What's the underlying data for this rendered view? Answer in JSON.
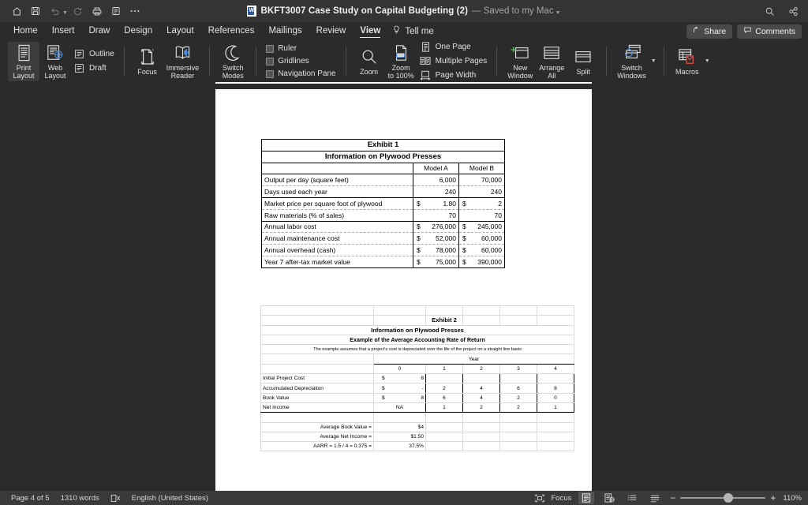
{
  "titlebar": {
    "title": "BKFT3007 Case Study on Capital Budgeting (2)",
    "save_state": "— Saved to my Mac",
    "icons": [
      "home-icon",
      "save-icon",
      "undo-icon",
      "redo-icon",
      "print-icon",
      "quick-print-icon",
      "more-icon"
    ],
    "right_icons": [
      "search-icon",
      "share-link-icon"
    ]
  },
  "tabs": {
    "items": [
      {
        "label": "Home",
        "active": false
      },
      {
        "label": "Insert",
        "active": false
      },
      {
        "label": "Draw",
        "active": false
      },
      {
        "label": "Design",
        "active": false
      },
      {
        "label": "Layout",
        "active": false
      },
      {
        "label": "References",
        "active": false
      },
      {
        "label": "Mailings",
        "active": false
      },
      {
        "label": "Review",
        "active": false
      },
      {
        "label": "View",
        "active": true
      }
    ],
    "tell_me": "Tell me",
    "share_label": "Share",
    "comments_label": "Comments"
  },
  "ribbon": {
    "views": [
      {
        "label": "Print\nLayout",
        "icon": "print-layout-icon",
        "selected": true
      },
      {
        "label": "Web\nLayout",
        "icon": "web-layout-icon",
        "selected": false
      }
    ],
    "view_small": [
      {
        "label": "Outline",
        "icon": "outline-icon"
      },
      {
        "label": "Draft",
        "icon": "draft-icon"
      }
    ],
    "immersive": [
      {
        "label": "Focus",
        "icon": "focus-icon"
      },
      {
        "label": "Immersive\nReader",
        "icon": "immersive-reader-icon"
      },
      {
        "label": "Switch\nModes",
        "icon": "switch-modes-icon"
      }
    ],
    "show": [
      {
        "label": "Ruler",
        "checked": false
      },
      {
        "label": "Gridlines",
        "checked": false
      },
      {
        "label": "Navigation Pane",
        "checked": false
      }
    ],
    "zoom_group": [
      {
        "label": "Zoom",
        "icon": "zoom-icon"
      },
      {
        "label": "Zoom\nto 100%",
        "icon": "zoom-100-icon"
      }
    ],
    "zoom_small": [
      {
        "label": "One Page",
        "icon": "one-page-icon"
      },
      {
        "label": "Multiple Pages",
        "icon": "multiple-pages-icon"
      },
      {
        "label": "Page Width",
        "icon": "page-width-icon"
      }
    ],
    "window": [
      {
        "label": "New\nWindow",
        "icon": "new-window-icon"
      },
      {
        "label": "Arrange\nAll",
        "icon": "arrange-all-icon"
      },
      {
        "label": "Split",
        "icon": "split-icon"
      },
      {
        "label": "Switch\nWindows",
        "icon": "switch-windows-icon"
      }
    ],
    "macros": [
      {
        "label": "Macros",
        "icon": "macros-icon"
      }
    ]
  },
  "exhibit1": {
    "title": "Exhibit 1",
    "subtitle": "Information on Plywood Presses",
    "columns": [
      "",
      "Model A",
      "Model B"
    ],
    "rows": [
      {
        "label": "Output per day (square feet)",
        "a": "6,000",
        "b": "70,000",
        "a_dollar": false,
        "b_dollar": false
      },
      {
        "label": "Days used each year",
        "a": "240",
        "b": "240",
        "a_dollar": false,
        "b_dollar": false
      },
      {
        "label": "Market price per square foot of plywood",
        "a": "1.80",
        "b": "2",
        "a_dollar": true,
        "b_dollar": true
      },
      {
        "label": "Raw materials (% of sales)",
        "a": "70",
        "b": "70",
        "a_dollar": false,
        "b_dollar": false
      },
      {
        "label": "Annual labor cost",
        "a": "276,000",
        "b": "245,000",
        "a_dollar": true,
        "b_dollar": true
      },
      {
        "label": "Annual maintenance cost",
        "a": "52,000",
        "b": "60,000",
        "a_dollar": true,
        "b_dollar": true
      },
      {
        "label": "Annual overhead (cash)",
        "a": "78,000",
        "b": "60,000",
        "a_dollar": true,
        "b_dollar": true
      },
      {
        "label": "Year 7 after-tax market value",
        "a": "75,000",
        "b": "390,000",
        "a_dollar": true,
        "b_dollar": true
      }
    ]
  },
  "exhibit2": {
    "title": "Exhibit 2",
    "subtitle": "Information on Plywood Presses",
    "subtitle2": "Example of the Average Accounting Rate of Return",
    "note": "The example assumes that a project's cost is depreciated over the life of the project on a straight line basis",
    "year_header": "Year",
    "year_cols": [
      "0",
      "1",
      "2",
      "3",
      "4"
    ],
    "rows": [
      {
        "label": "Initial Project Cost",
        "y0": "8",
        "y0_dollar": true,
        "y1": "",
        "y2": "",
        "y3": "",
        "y4": ""
      },
      {
        "label": "Accumulated Depreciation",
        "y0": "-",
        "y0_dollar": true,
        "y1": "2",
        "y2": "4",
        "y3": "6",
        "y4": "8"
      },
      {
        "label": "Book Value",
        "y0": "8",
        "y0_dollar": true,
        "y1": "6",
        "y2": "4",
        "y3": "2",
        "y4": "0"
      },
      {
        "label": "Net Income",
        "y0": "NA",
        "y0_dollar": false,
        "y1": "1",
        "y2": "2",
        "y3": "2",
        "y4": "1"
      }
    ],
    "summary": [
      {
        "label": "Average Book Value =",
        "value": "$4"
      },
      {
        "label": "Average Net Income =",
        "value": "$1.50"
      },
      {
        "label": "AARR = 1.5 / 4 = 0.375 =",
        "value": "37.5%"
      }
    ]
  },
  "statusbar": {
    "page": "Page 4 of 5",
    "words": "1310 words",
    "language": "English (United States)",
    "proofing_icon": "proofing-icon",
    "focus_label": "Focus",
    "zoom_level": "110%",
    "zoom_out": "−",
    "zoom_in": "+"
  }
}
